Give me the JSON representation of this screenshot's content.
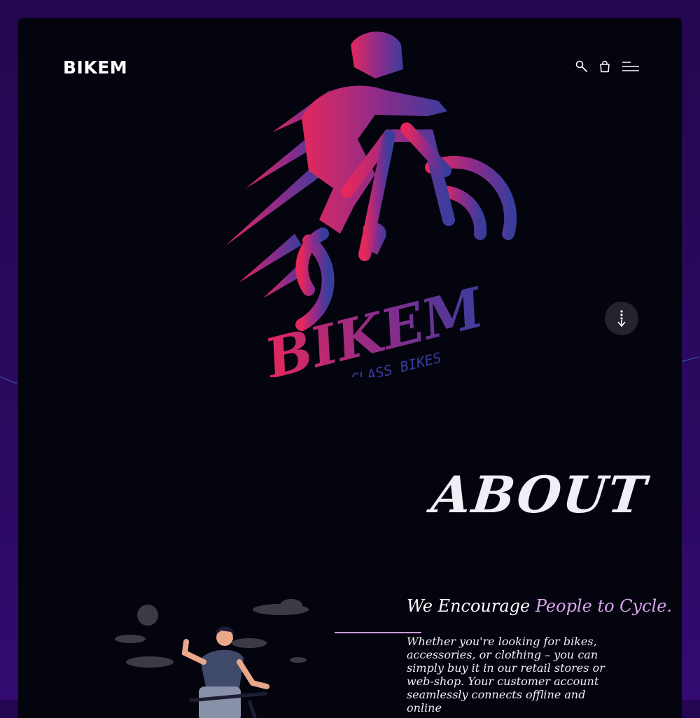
{
  "header": {
    "brand": "BIKEM",
    "icons": [
      "search-icon",
      "shopping-bag-icon",
      "menu-icon"
    ]
  },
  "hero": {
    "logo_wordmark": "BIKEM",
    "logo_tagline": "TOP CLASS BIKES",
    "scroll_icon": "scroll-down-icon"
  },
  "about": {
    "title": "ABOUT",
    "headline_part1": "We Encourage ",
    "headline_accent": "People to Cycle.",
    "body": "Whether you're looking for bikes, accessories, or clothing – you can simply buy it in our retail stores or web-shop. Your customer account seamlessly connects offline and online"
  },
  "colors": {
    "background": "#2a0a5e",
    "panel": "#04040f",
    "accent": "#d9a6ee",
    "logo_gradient_start": "#e4285c",
    "logo_gradient_end": "#3a3d9c"
  }
}
